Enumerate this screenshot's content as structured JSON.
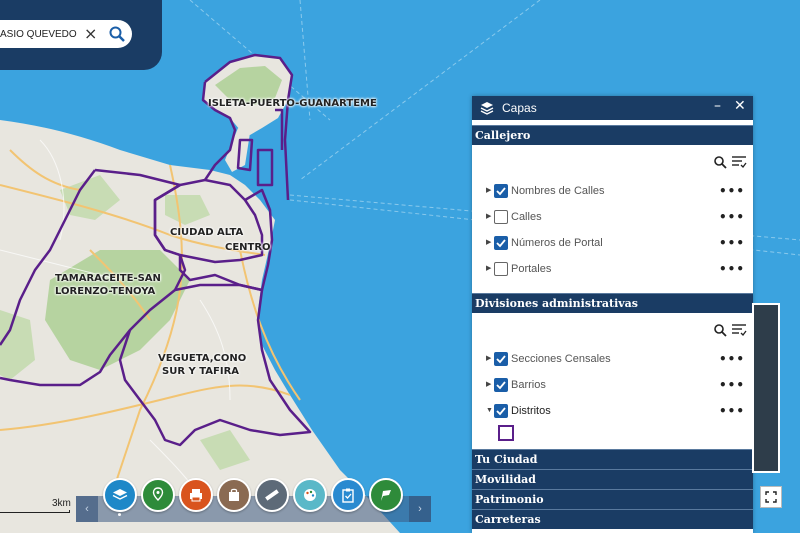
{
  "search": {
    "value": "ASIO QUEVEDO"
  },
  "map": {
    "district_labels": [
      "ISLETA-PUERTO-GUANARTEME",
      "CIUDAD ALTA",
      "CENTRO",
      "TAMARACEITE-SAN",
      "LORENZO-TENOYA",
      "VEGUETA,CONO",
      "SUR Y TAFIRA"
    ],
    "scale_label": "3km",
    "colors": {
      "sea": "#3ba3df",
      "land": "#e8e6df",
      "park": "#b6d3a0",
      "district_border": "#5a1f8a",
      "road": "#f5c97a"
    }
  },
  "layers_panel": {
    "title": "Capas",
    "icons": {
      "header": "layers-icon",
      "minimize": "minimize-icon",
      "close": "close-icon"
    },
    "sections": [
      {
        "name": "Callejero",
        "layers": [
          {
            "label": "Nombres de Calles",
            "checked": true,
            "expandable": true
          },
          {
            "label": "Calles",
            "checked": false,
            "expandable": true
          },
          {
            "label": "Números de Portal",
            "checked": true,
            "expandable": true
          },
          {
            "label": "Portales",
            "checked": false,
            "expandable": true
          }
        ]
      },
      {
        "name": "Divisiones administrativas",
        "layers": [
          {
            "label": "Secciones Censales",
            "checked": true,
            "expandable": true
          },
          {
            "label": "Barrios",
            "checked": true,
            "expandable": true
          },
          {
            "label": "Distritos",
            "checked": true,
            "expanded": true
          }
        ]
      }
    ],
    "collapsed_sections": [
      "Tu Ciudad",
      "Movilidad",
      "Patrimonio",
      "Carreteras"
    ],
    "more_options": "•••"
  },
  "toolbar": {
    "prev": "‹",
    "next": "›",
    "tools": [
      {
        "icon": "layers-icon",
        "color": "#1e88c8"
      },
      {
        "icon": "map-pin-icon",
        "color": "#2e8b3a"
      },
      {
        "icon": "print-icon",
        "color": "#d9541e"
      },
      {
        "icon": "bag-icon",
        "color": "#8a6a52"
      },
      {
        "icon": "ruler-icon",
        "color": "#5d6a78"
      },
      {
        "icon": "palette-icon",
        "color": "#5ab8c8"
      },
      {
        "icon": "clipboard-icon",
        "color": "#2a8ad0"
      },
      {
        "icon": "flag-icon",
        "color": "#2e8b3a"
      }
    ]
  }
}
